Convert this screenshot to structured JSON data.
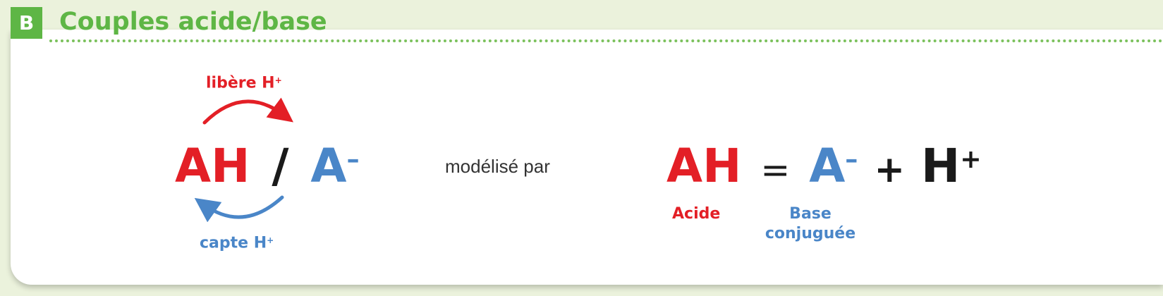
{
  "section": {
    "letter": "B",
    "title": "Couples acide/base"
  },
  "left": {
    "top_label": "libère H",
    "top_label_sup": "+",
    "acid": "AH",
    "slash": "/",
    "base": "A",
    "base_sup": "–",
    "bottom_label": "capte H",
    "bottom_label_sup": "+"
  },
  "middle_text": "modélisé par",
  "equation": {
    "acid": "AH",
    "equals": "=",
    "base": "A",
    "base_sup": "–",
    "plus": "+",
    "proton": "H",
    "proton_sup": "+"
  },
  "labels": {
    "acid": "Acide",
    "base_line1": "Base",
    "base_line2": "conjuguée"
  },
  "colors": {
    "accent": "#5eb645",
    "acid": "#e31f26",
    "base": "#4a86c8",
    "text": "#1a1a1a",
    "background": "#ebf2dc"
  }
}
